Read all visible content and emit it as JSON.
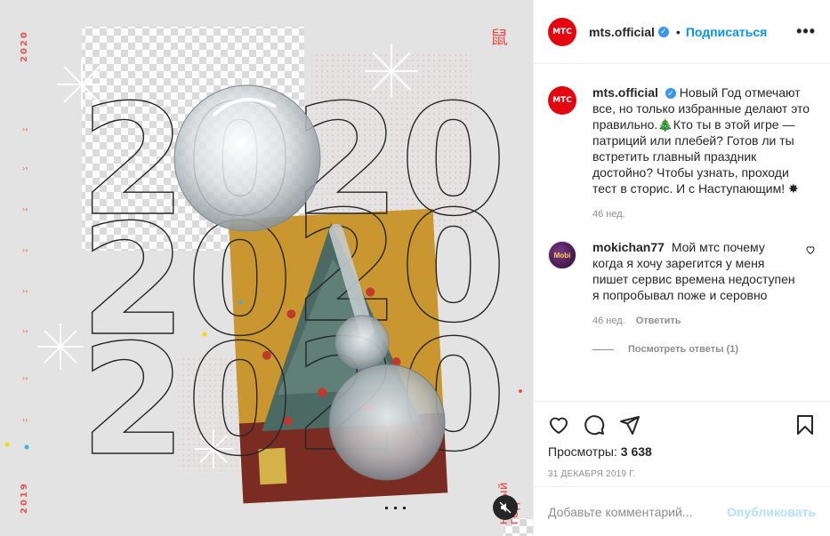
{
  "media": {
    "side_year_top": "2020",
    "side_year_bottom": "2019",
    "rat_glyph": "鼠",
    "big_numbers": [
      "20",
      "20",
      "20",
      "20",
      "20",
      "20"
    ],
    "new_year_tag": "НОВЫЙ ГОД",
    "mute_icon": "speaker-muted-icon"
  },
  "header": {
    "avatar_text": "МТС",
    "username": "mts.official",
    "separator": "•",
    "follow_label": "Подписаться",
    "more_label": "•••"
  },
  "caption": {
    "avatar_text": "МТС",
    "username": "mts.official",
    "text": "Новый Год отмечают все, но только избранные делают это правильно.🎄Кто ты в этой игре — патриций или плебей? Готов ли ты встретить главный праздник достойно? Чтобы узнать, проходи тест в сторис. И с Наступающим! ✸",
    "time": "46 нед."
  },
  "comment1": {
    "avatar_text": "Mobi",
    "username": "mokichan77",
    "text": "Мой мтс почему когда я хочу зарегится у меня пишет сервис времена недоступен я попробывал поже и серовно",
    "time": "46 нед.",
    "reply_label": "Ответить",
    "view_replies_label": "Посмотреть ответы (1)"
  },
  "actions": {
    "icons": [
      "heart-icon",
      "comment-icon",
      "share-icon",
      "bookmark-icon"
    ],
    "views_label": "Просмотры:",
    "views_count": "3 638",
    "date": "31 декабря 2019 г."
  },
  "add_comment": {
    "placeholder": "Добавьте комментарий...",
    "publish_label": "Опубликовать"
  },
  "colors": {
    "brand_red": "#e30611",
    "accent_blue": "#0095f6",
    "muted_text": "#8e8e8e"
  }
}
